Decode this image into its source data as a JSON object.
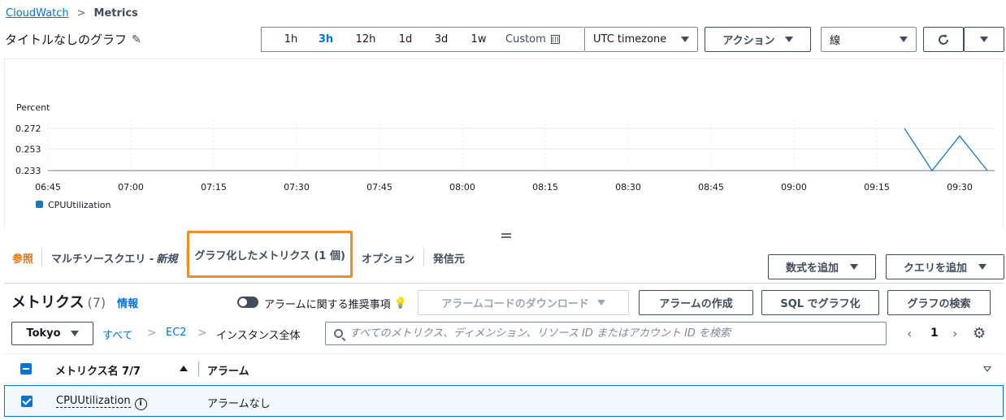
{
  "breadcrumb": {
    "root": "CloudWatch",
    "current": "Metrics"
  },
  "graph": {
    "title": "タイトルなしのグラフ"
  },
  "timerange": {
    "options": [
      "1h",
      "3h",
      "12h",
      "1d",
      "3d",
      "1w"
    ],
    "active": "3h",
    "custom_label": "Custom",
    "timezone": "UTC timezone"
  },
  "toolbar": {
    "actions_label": "アクション",
    "chart_type": "線"
  },
  "chart_data": {
    "type": "line",
    "ylabel": "Percent",
    "y_ticks": [
      0.233,
      0.253,
      0.272
    ],
    "x_ticks": [
      "06:45",
      "07:00",
      "07:15",
      "07:30",
      "07:45",
      "08:00",
      "08:15",
      "08:30",
      "08:45",
      "09:00",
      "09:15",
      "09:30"
    ],
    "ylim": [
      0.233,
      0.272
    ],
    "grid": true,
    "legend_position": "bottom-left",
    "series": [
      {
        "name": "CPUUtilization",
        "color": "#1f77b4",
        "points": [
          {
            "x": "09:20",
            "y": 0.272
          },
          {
            "x": "09:25",
            "y": 0.233
          },
          {
            "x": "09:30",
            "y": 0.265
          },
          {
            "x": "09:35",
            "y": 0.233
          }
        ]
      }
    ]
  },
  "tabs": [
    {
      "label": "参照",
      "active": true
    },
    {
      "label": "マルチソースクエリ - ",
      "label_suffix": "新規"
    },
    {
      "label": "グラフ化したメトリクス (1 個)",
      "highlighted": true
    },
    {
      "label": "オプション"
    },
    {
      "label": "発信元"
    }
  ],
  "right_buttons": {
    "add_math": "数式を追加",
    "add_query": "クエリを追加"
  },
  "metrics": {
    "title": "メトリクス",
    "count": "(7)",
    "info": "情報",
    "alarm_toggle_label": "アラームに関する推奨事項",
    "download_alarm_code": "アラームコードのダウンロード",
    "create_alarm": "アラームの作成",
    "graph_sql": "SQL でグラフ化",
    "graph_search": "グラフの検索"
  },
  "filter": {
    "region": "Tokyo",
    "path": [
      "すべて",
      "EC2",
      "インスタンス全体"
    ],
    "search_placeholder": "すべてのメトリクス、ディメンション、リソース ID またはアカウント ID を検索",
    "page": "1"
  },
  "table": {
    "headers": {
      "name": "メトリクス名 7/7",
      "alarm": "アラーム"
    },
    "rows": [
      {
        "name": "CPUUtilization",
        "alarm": "アラームなし"
      }
    ]
  }
}
